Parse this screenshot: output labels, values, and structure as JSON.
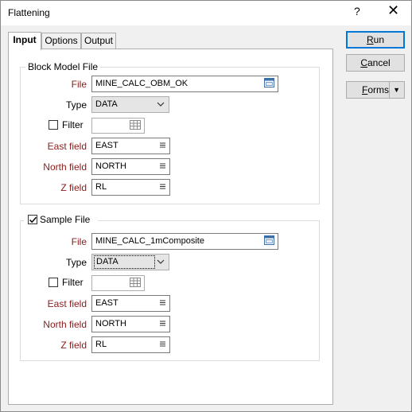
{
  "window": {
    "title": "Flattening",
    "help_glyph": "?",
    "close_glyph": "✕"
  },
  "tabs": [
    {
      "label": "Input"
    },
    {
      "label": "Options"
    },
    {
      "label": "Output"
    }
  ],
  "buttons": {
    "run": {
      "label": "Run",
      "mnemonic": "R",
      "rest": "un"
    },
    "cancel": {
      "label": "Cancel",
      "mnemonic": "C",
      "rest": "ancel"
    },
    "forms": {
      "label": "Forms",
      "mnemonic": "F",
      "rest": "orms",
      "arrow": "▼"
    }
  },
  "block_model": {
    "legend": "Block Model File",
    "file_label": "File",
    "file_value": "MINE_CALC_OBM_OK",
    "type_label": "Type",
    "type_value": "DATA",
    "filter_label": "Filter",
    "filter_checked": false,
    "east_label": "East field",
    "east_value": "EAST",
    "north_label": "North field",
    "north_value": "NORTH",
    "z_label": "Z field",
    "z_value": "RL"
  },
  "sample": {
    "legend": "Sample File",
    "legend_checked": true,
    "file_label": "File",
    "file_value": "MINE_CALC_1mComposite",
    "type_label": "Type",
    "type_value": "DATA",
    "filter_label": "Filter",
    "filter_checked": false,
    "east_label": "East field",
    "east_value": "EAST",
    "north_label": "North field",
    "north_value": "NORTH",
    "z_label": "Z field",
    "z_value": "RL"
  },
  "colors": {
    "required_label": "#8b1a1a",
    "accent": "#0078d7"
  },
  "icons": {
    "file_browse": "file-browse-icon",
    "field_list": "list-icon",
    "filter_table": "table-icon",
    "dropdown": "chevron-down-icon"
  }
}
